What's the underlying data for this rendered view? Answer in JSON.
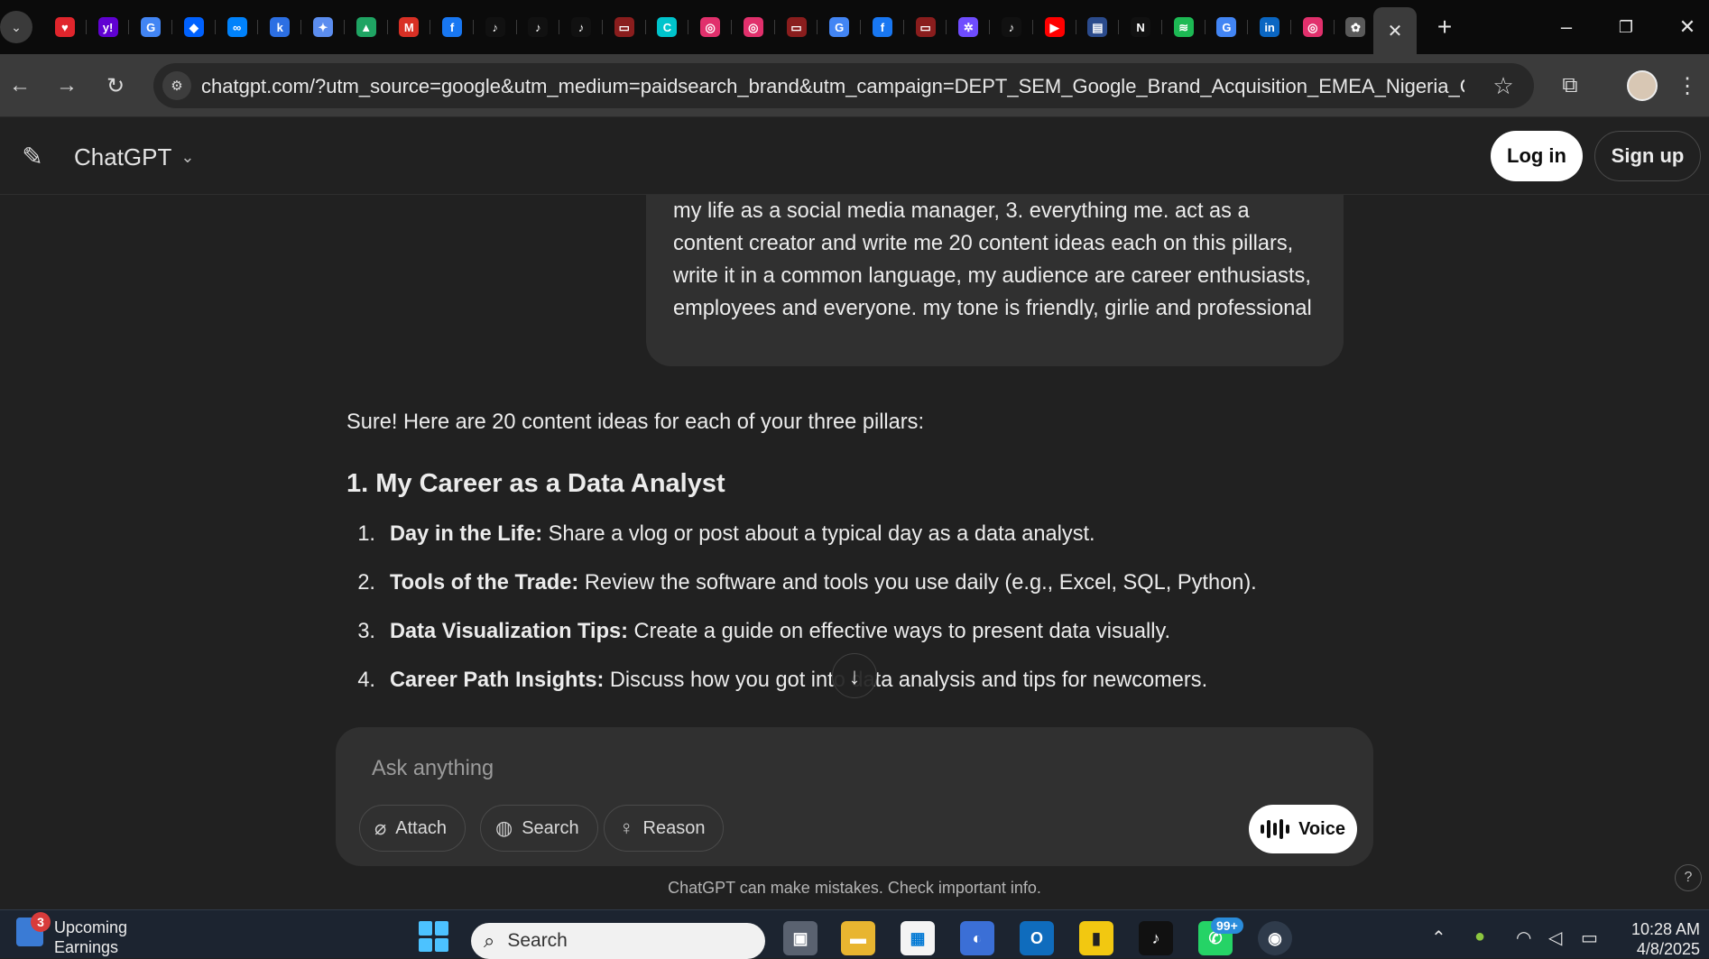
{
  "browser": {
    "active_tab_close": "✕",
    "new_tab": "+",
    "url": "chatgpt.com/?utm_source=google&utm_medium=paidsearch_brand&utm_campaign=DEPT_SEM_Google_Brand_Acquisition_EMEA_Nigeria_Consumer...",
    "pinned_tabs": [
      {
        "icon": "heart-icon",
        "glyph": "♥",
        "color": "#e0252c"
      },
      {
        "icon": "yahoo-icon",
        "glyph": "y!",
        "color": "#6001d2"
      },
      {
        "icon": "google-icon",
        "glyph": "G",
        "color": "#4285f4"
      },
      {
        "icon": "dropbox-icon",
        "glyph": "◆",
        "color": "#0061fe"
      },
      {
        "icon": "meta-icon",
        "glyph": "∞",
        "color": "#0082fb"
      },
      {
        "icon": "klarna-icon",
        "glyph": "k",
        "color": "#2c6fe3"
      },
      {
        "icon": "gemini-icon",
        "glyph": "✦",
        "color": "#5b8def"
      },
      {
        "icon": "drive-icon",
        "glyph": "▲",
        "color": "#1fa463"
      },
      {
        "icon": "gmail-icon",
        "glyph": "M",
        "color": "#d93025"
      },
      {
        "icon": "facebook-icon",
        "glyph": "f",
        "color": "#1877f2"
      },
      {
        "icon": "tiktok-icon",
        "glyph": "♪",
        "color": "#111111"
      },
      {
        "icon": "tiktok-icon",
        "glyph": "♪",
        "color": "#111111"
      },
      {
        "icon": "tiktok-icon",
        "glyph": "♪",
        "color": "#111111"
      },
      {
        "icon": "app-icon",
        "glyph": "▭",
        "color": "#8a1d1d"
      },
      {
        "icon": "canva-icon",
        "glyph": "C",
        "color": "#00c4cc"
      },
      {
        "icon": "instagram-icon",
        "glyph": "◎",
        "color": "#e1306c"
      },
      {
        "icon": "instagram-icon",
        "glyph": "◎",
        "color": "#e1306c"
      },
      {
        "icon": "app-icon",
        "glyph": "▭",
        "color": "#8a1d1d"
      },
      {
        "icon": "google-icon",
        "glyph": "G",
        "color": "#4285f4"
      },
      {
        "icon": "facebook-icon",
        "glyph": "f",
        "color": "#1877f2"
      },
      {
        "icon": "app-icon",
        "glyph": "▭",
        "color": "#8a1d1d"
      },
      {
        "icon": "sparkle-icon",
        "glyph": "✲",
        "color": "#6f4cff"
      },
      {
        "icon": "tiktok-icon",
        "glyph": "♪",
        "color": "#111111"
      },
      {
        "icon": "youtube-icon",
        "glyph": "▶",
        "color": "#ff0000"
      },
      {
        "icon": "doc-icon",
        "glyph": "▤",
        "color": "#2b4b8c"
      },
      {
        "icon": "notion-icon",
        "glyph": "N",
        "color": "#111111"
      },
      {
        "icon": "spotify-icon",
        "glyph": "≋",
        "color": "#1db954"
      },
      {
        "icon": "google-icon",
        "glyph": "G",
        "color": "#4285f4"
      },
      {
        "icon": "linkedin-icon",
        "glyph": "in",
        "color": "#0a66c2"
      },
      {
        "icon": "instagram-icon",
        "glyph": "◎",
        "color": "#e1306c"
      },
      {
        "icon": "chatgpt-icon",
        "glyph": "✿",
        "color": "#5a5a5a"
      }
    ]
  },
  "header": {
    "model_name": "ChatGPT",
    "login_label": "Log in",
    "signup_label": "Sign up"
  },
  "conversation": {
    "user_message": "my life as a social media manager, 3. everything me. act as a content creator and write me 20 content ideas each on this pillars, write it in a common language, my audience are career enthusiasts, employees and everyone. my tone is friendly, girlie and professional",
    "assistant_intro": "Sure! Here are 20 content ideas for each of your three pillars:",
    "section_title": "1. My Career as a Data Analyst",
    "ideas": [
      {
        "num": "1.",
        "title": "Day in the Life:",
        "text": " Share a vlog or post about a typical day as a data analyst."
      },
      {
        "num": "2.",
        "title": "Tools of the Trade:",
        "text": " Review the software and tools you use daily (e.g., Excel, SQL, Python)."
      },
      {
        "num": "3.",
        "title": "Data Visualization Tips:",
        "text": " Create a guide on effective ways to present data visually."
      },
      {
        "num": "4.",
        "title": "Career Path Insights:",
        "text": " Discuss how you got into data analysis and tips for newcomers."
      }
    ]
  },
  "composer": {
    "placeholder": "Ask anything",
    "attach_label": "Attach",
    "search_label": "Search",
    "reason_label": "Reason",
    "voice_label": "Voice",
    "disclaimer": "ChatGPT can make mistakes. Check important info."
  },
  "taskbar": {
    "weather_title": "Upcoming",
    "weather_sub": "Earnings",
    "weather_badge": "3",
    "search_label": "Search",
    "whatsapp_badge": "99+",
    "time": "10:28 AM",
    "date": "4/8/2025"
  }
}
